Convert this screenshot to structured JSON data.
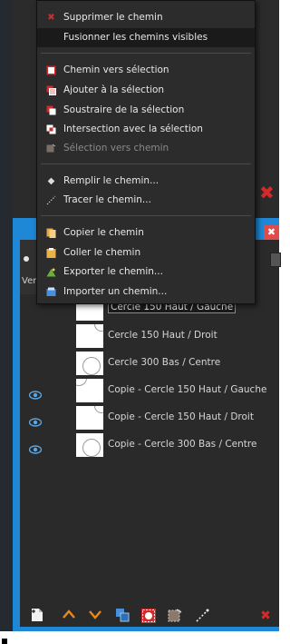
{
  "menu": {
    "items": [
      {
        "label": "Supprimer le chemin",
        "icon": "delete-path-icon"
      },
      {
        "label": "Fusionner les chemins visibles",
        "icon": "",
        "highlighted": true
      },
      {
        "label": "Chemin vers sélection",
        "icon": "path-to-selection-icon"
      },
      {
        "label": "Ajouter à la sélection",
        "icon": "add-to-selection-icon"
      },
      {
        "label": "Soustraire de la sélection",
        "icon": "subtract-selection-icon"
      },
      {
        "label": "Intersection avec la sélection",
        "icon": "intersect-selection-icon"
      },
      {
        "label": "Sélection vers chemin",
        "icon": "selection-to-path-icon",
        "disabled": true
      },
      {
        "label": "Remplir le chemin...",
        "icon": "fill-path-icon"
      },
      {
        "label": "Tracer le chemin...",
        "icon": "stroke-path-icon"
      },
      {
        "label": "Copier le chemin",
        "icon": "copy-path-icon"
      },
      {
        "label": "Coller le chemin",
        "icon": "paste-path-icon"
      },
      {
        "label": "Exporter le chemin...",
        "icon": "export-path-icon"
      },
      {
        "label": "Importer un chemin...",
        "icon": "import-path-icon"
      }
    ]
  },
  "panel": {
    "tab_label": "Ver"
  },
  "layers": [
    {
      "name": "Cercle 150 Haut / Gauche",
      "visible": false,
      "editing": true,
      "thumb": "small-circle"
    },
    {
      "name": "Cercle 150  Haut / Droit",
      "visible": false,
      "thumb": "small-circle"
    },
    {
      "name": "Cercle 300 Bas / Centre",
      "visible": false,
      "thumb": "large-circle"
    },
    {
      "name": "Copie - Cercle 150 Haut / Gauche",
      "visible": true,
      "thumb": "small-circle"
    },
    {
      "name": "Copie - Cercle 150  Haut / Droit",
      "visible": true,
      "thumb": "small-circle"
    },
    {
      "name": "Copie - Cercle 300 Bas / Centre",
      "visible": true,
      "thumb": "large-circle"
    }
  ],
  "toolbar": {
    "icons": [
      "new-path-icon",
      "raise-icon",
      "lower-icon",
      "duplicate-icon",
      "path-to-selection-icon",
      "selection-to-path-icon",
      "stroke-icon",
      "delete-icon"
    ]
  },
  "colors": {
    "accent_blue": "#1e88d6",
    "red": "#d42a2a",
    "orange": "#e88a1a",
    "eye": "#5aa7e6"
  }
}
